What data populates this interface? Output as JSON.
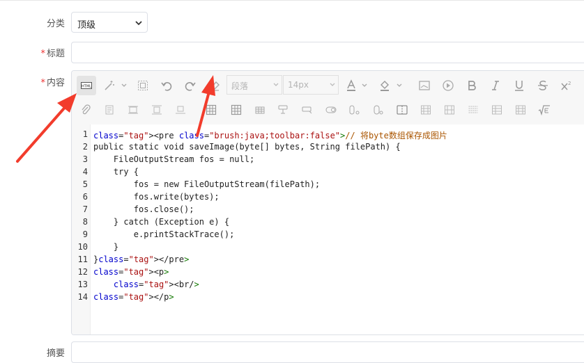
{
  "form": {
    "category_label": "分类",
    "category_value": "顶级",
    "title_label": "标题",
    "content_label": "内容",
    "summary_label": "摘要",
    "required_mark": "*"
  },
  "toolbar": {
    "paragraph_placeholder": "段落",
    "fontsize_placeholder": "14px",
    "html_icon_text": "HTML"
  },
  "code": {
    "lines": [
      "<pre class=\"brush:java;toolbar:false\">// 将byte数组保存成图片",
      "public static void saveImage(byte[] bytes, String filePath) {",
      "    FileOutputStream fos = null;",
      "    try {",
      "        fos = new FileOutputStream(filePath);",
      "        fos.write(bytes);",
      "        fos.close();",
      "    } catch (Exception e) {",
      "        e.printStackTrace();",
      "    }",
      "}</pre>",
      "<p>",
      "    <br/>",
      "</p>"
    ],
    "line_numbers": [
      "1",
      "2",
      "3",
      "4",
      "5",
      "6",
      "7",
      "8",
      "9",
      "10",
      "11",
      "12",
      "13",
      "14"
    ]
  },
  "colors": {
    "arrow": "#f23c2c",
    "tag": "#117700",
    "attr": "#0000cc",
    "string": "#aa1111",
    "comment": "#aa5500"
  }
}
